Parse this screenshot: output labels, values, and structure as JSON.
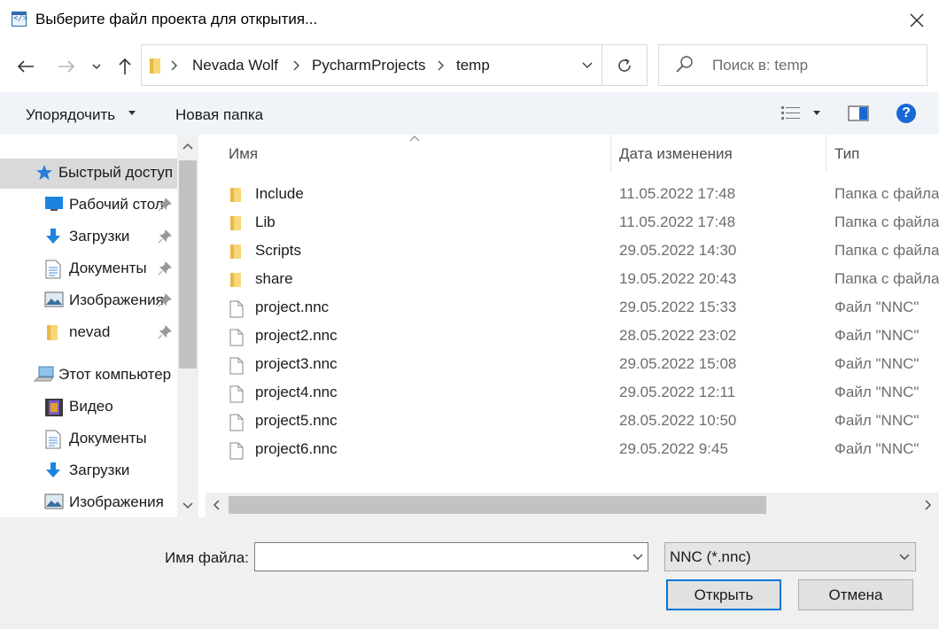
{
  "window": {
    "title": "Выберите файл проекта для открытия..."
  },
  "address": {
    "crumbs": [
      "Nevada Wolf",
      "PycharmProjects",
      "temp"
    ]
  },
  "search": {
    "placeholder": "Поиск в: temp"
  },
  "toolbar": {
    "organize": "Упорядочить",
    "new_folder": "Новая папка",
    "help": "?"
  },
  "nav": {
    "items": [
      {
        "label": "Быстрый доступ",
        "icon": "star-icon",
        "pinned": false
      },
      {
        "label": "Рабочий стол",
        "icon": "desktop-icon",
        "pinned": true
      },
      {
        "label": "Загрузки",
        "icon": "download-icon",
        "pinned": true
      },
      {
        "label": "Документы",
        "icon": "document-icon",
        "pinned": true
      },
      {
        "label": "Изображения",
        "icon": "pictures-icon",
        "pinned": true
      },
      {
        "label": "nevad",
        "icon": "folder-icon",
        "pinned": true
      },
      {
        "label": "Этот компьютер",
        "icon": "computer-icon",
        "pinned": false
      },
      {
        "label": "Видео",
        "icon": "video-icon",
        "pinned": false
      },
      {
        "label": "Документы",
        "icon": "document-icon",
        "pinned": false
      },
      {
        "label": "Загрузки",
        "icon": "download-icon",
        "pinned": false
      },
      {
        "label": "Изображения",
        "icon": "pictures-icon",
        "pinned": false
      }
    ]
  },
  "files": {
    "columns": [
      "Имя",
      "Дата изменения",
      "Тип"
    ],
    "rows": [
      {
        "name": "Include",
        "date": "11.05.2022 17:48",
        "type": "Папка с файлами",
        "kind": "folder"
      },
      {
        "name": "Lib",
        "date": "11.05.2022 17:48",
        "type": "Папка с файлами",
        "kind": "folder"
      },
      {
        "name": "Scripts",
        "date": "29.05.2022 14:30",
        "type": "Папка с файлами",
        "kind": "folder"
      },
      {
        "name": "share",
        "date": "19.05.2022 20:43",
        "type": "Папка с файлами",
        "kind": "folder"
      },
      {
        "name": "project.nnc",
        "date": "29.05.2022 15:33",
        "type": "Файл \"NNC\"",
        "kind": "file"
      },
      {
        "name": "project2.nnc",
        "date": "28.05.2022 23:02",
        "type": "Файл \"NNC\"",
        "kind": "file"
      },
      {
        "name": "project3.nnc",
        "date": "29.05.2022 15:08",
        "type": "Файл \"NNC\"",
        "kind": "file"
      },
      {
        "name": "project4.nnc",
        "date": "29.05.2022 12:11",
        "type": "Файл \"NNC\"",
        "kind": "file"
      },
      {
        "name": "project5.nnc",
        "date": "28.05.2022 10:50",
        "type": "Файл \"NNC\"",
        "kind": "file"
      },
      {
        "name": "project6.nnc",
        "date": "29.05.2022 9:45",
        "type": "Файл \"NNC\"",
        "kind": "file"
      }
    ]
  },
  "bottom": {
    "filename_label": "Имя файла:",
    "filename_value": "",
    "filter": "NNC (*.nnc)",
    "open": "Открыть",
    "cancel": "Отмена"
  },
  "colors": {
    "accent": "#0078d7",
    "folder": "#f8d775",
    "selected": "#d9d9d9"
  }
}
